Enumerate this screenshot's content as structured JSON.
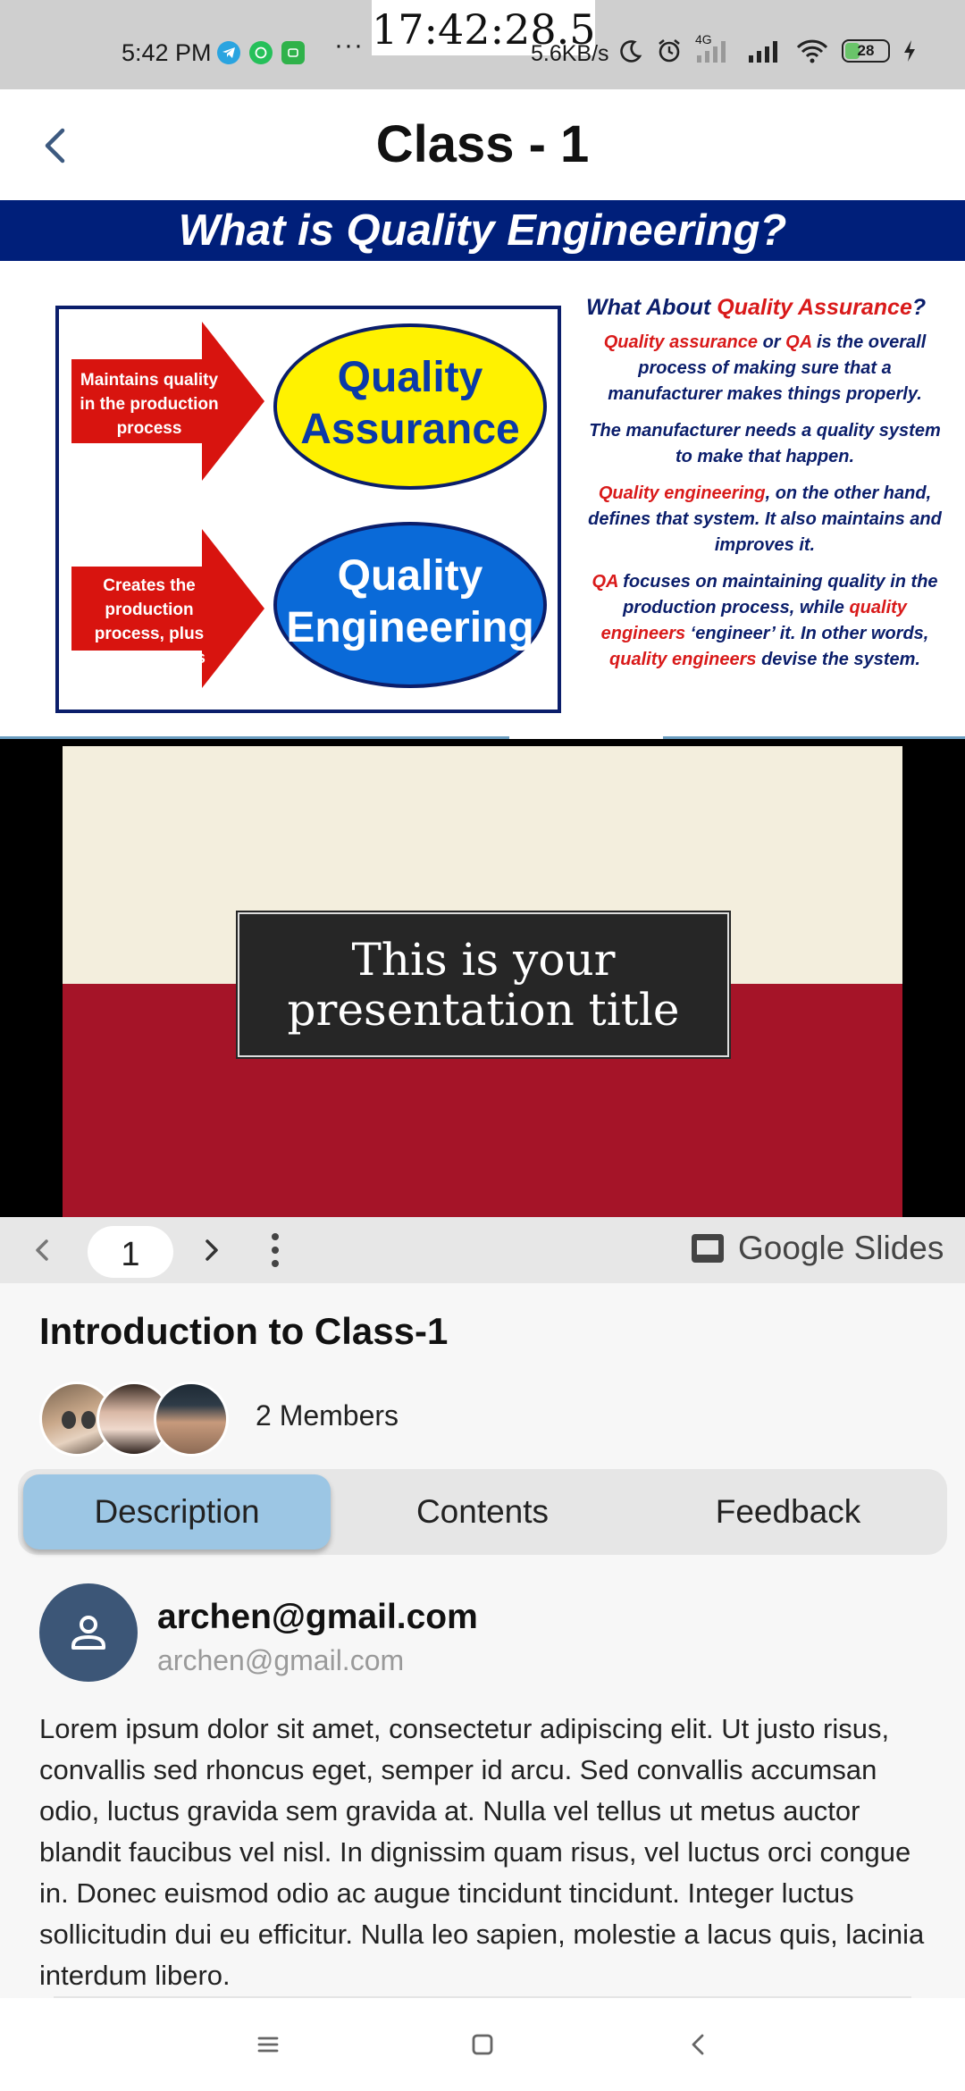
{
  "status_bar": {
    "time": "5:42 PM",
    "clock_overlay": "17:42:28.5",
    "net_speed": "5.6KB/s",
    "network_type": "4G",
    "battery_level": "28",
    "icons": [
      "telegram-icon",
      "whatsapp-icon",
      "messaging-icon",
      "more-dots-icon",
      "moon-icon",
      "alarm-icon",
      "signal-icon",
      "wifi-icon",
      "battery-icon",
      "charging-icon"
    ],
    "dots": "···"
  },
  "header": {
    "title": "Class - 1",
    "back_icon": "chevron-left-icon"
  },
  "slide1": {
    "banner": "What is Quality Engineering?",
    "arrow1_text": "Maintains quality in the production process",
    "arrow2_text": "Creates the production process, plus what QA does",
    "oval1_line1": "Quality",
    "oval1_line2": "Assurance",
    "oval2_line1": "Quality",
    "oval2_line2": "Engineering",
    "right_heading_a": "What About ",
    "right_heading_b": "Quality Assurance",
    "right_heading_c": "?",
    "p1_a": "Quality assurance",
    "p1_b": " or ",
    "p1_c": "QA",
    "p1_d": " is the overall process of making sure that a manufacturer makes things properly.",
    "p2": "The manufacturer needs a quality system to make that happen.",
    "p3_a": "Quality engineering",
    "p3_b": ", on the other hand, defines that system. It also maintains and improves it.",
    "p4_a": "QA",
    "p4_b": " focuses on maintaining quality in the production process, while ",
    "p4_c": "quality engineers",
    "p4_d": " ‘engineer’ it. In other words, ",
    "p4_e": "quality engineers",
    "p4_f": " devise the system.",
    "colors": {
      "banner": "#001f7a",
      "red": "#d91a1a",
      "yellow": "#fff200",
      "blue": "#0a6ad8"
    }
  },
  "slide_viewer": {
    "title_line1": "This is your",
    "title_line2": "presentation title",
    "page_number": "1",
    "brand": "Google Slides",
    "colors": {
      "cream": "#f3eedd",
      "crimson": "#a51428"
    }
  },
  "class_info": {
    "title": "Introduction to Class-1",
    "members": "2 Members",
    "tabs": [
      {
        "label": "Description",
        "active": true
      },
      {
        "label": "Contents",
        "active": false
      },
      {
        "label": "Feedback",
        "active": false
      }
    ],
    "author_name": "archen@gmail.com",
    "author_email": "archen@gmail.com",
    "description": "Lorem ipsum dolor sit amet, consectetur adipiscing elit. Ut justo risus, convallis sed rhoncus eget, semper id arcu. Sed convallis accumsan odio, luctus gravida sem gravida at. Nulla vel tellus ut metus auctor blandit faucibus vel nisl. In dignissim quam risus, vel luctus orci congue in. Donec euismod odio ac augue tincidunt tincidunt. Integer luctus sollicitudin dui eu efficitur. Nulla leo sapien, molestie a lacus quis, lacinia interdum libero."
  },
  "nav_bar": {
    "icons": [
      "menu-icon",
      "home-square-icon",
      "back-triangle-icon"
    ]
  }
}
